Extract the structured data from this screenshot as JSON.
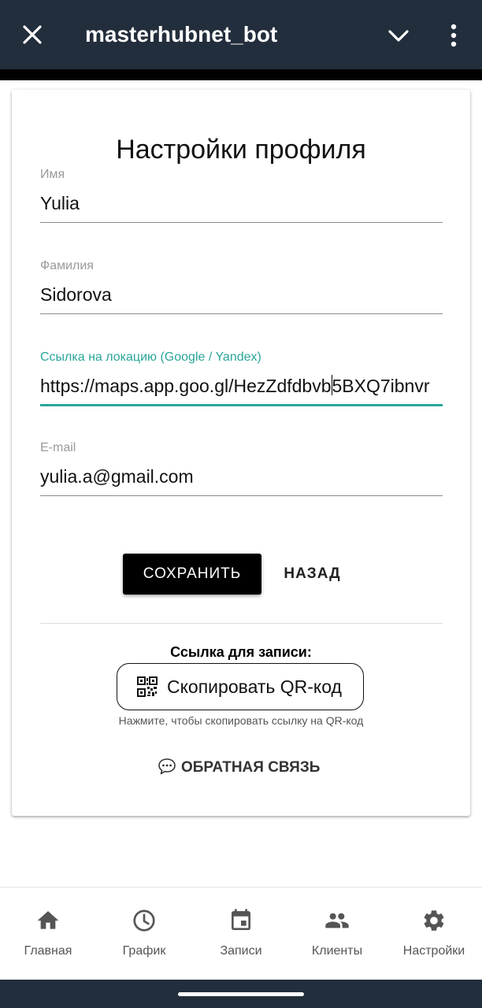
{
  "header": {
    "title": "masterhubnet_bot",
    "close_icon": "close-icon",
    "chevron_icon": "chevron-down-icon",
    "more_icon": "more-vert-icon"
  },
  "card": {
    "title": "Настройки профиля",
    "fields": [
      {
        "label": "Имя",
        "value": "Yulia"
      },
      {
        "label": "Фамилия",
        "value": "Sidorova"
      },
      {
        "label": "Ссылка на локацию (Google / Yandex)",
        "value_before_caret": "https://maps.app.goo.gl/HezZdfdbvb",
        "value_after_caret": "5BXQ7ibnvr"
      },
      {
        "label": "E-mail",
        "value": "yulia.a@gmail.com"
      }
    ],
    "save_label": "СОХРАНИТЬ",
    "back_label": "НАЗАД",
    "link_heading": "Ссылка для записи:",
    "qr_button_label": "Скопировать QR-код",
    "qr_hint": "Нажмите, чтобы скопировать ссылку на QR-код",
    "feedback_label": "ОБРАТНАЯ СВЯЗЬ"
  },
  "nav": {
    "items": [
      {
        "label": "Главная",
        "icon": "home-icon"
      },
      {
        "label": "График",
        "icon": "clock-icon"
      },
      {
        "label": "Записи",
        "icon": "calendar-icon"
      },
      {
        "label": "Клиенты",
        "icon": "people-icon"
      },
      {
        "label": "Настройки",
        "icon": "gear-icon"
      }
    ]
  },
  "colors": {
    "header_bg": "#232e3c",
    "accent": "#2aa59a",
    "button_bg": "#000000",
    "icon_gray": "#555555"
  }
}
